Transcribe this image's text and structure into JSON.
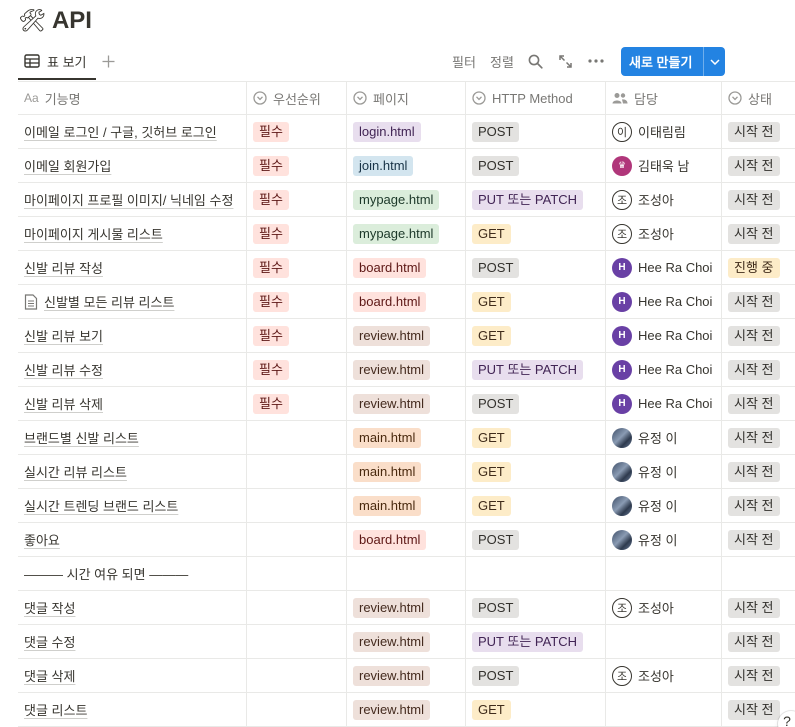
{
  "page": {
    "emoji": "🛠",
    "title": "API"
  },
  "toolbar": {
    "view_tab": "표 보기",
    "filter": "필터",
    "sort": "정렬",
    "new_button": "새로 만들기"
  },
  "columns": {
    "name": "기능명",
    "priority": "우선순위",
    "page": "페이지",
    "method": "HTTP Method",
    "assignee": "담당",
    "status": "상태"
  },
  "colors": {
    "priority_bg": "#ffe2dd",
    "priority_fg": "#5d1715",
    "method_bg": "#e3e2e0",
    "method_put_bg": "#e8deee",
    "method_get_bg": "#fdecc8",
    "status_todo_bg": "#e3e2e0",
    "status_doing_bg": "#fdecc8",
    "accent": "#2383e2"
  },
  "rows": [
    {
      "name": "이메일 로그인 / 구글, 깃허브 로그인",
      "priority": "필수",
      "page": "login.html",
      "page_color": "purple",
      "method": "POST",
      "assignee": "이태림림",
      "avatar": "outline",
      "avatar_text": "이",
      "status": "시작 전"
    },
    {
      "name": "이메일 회원가입",
      "priority": "필수",
      "page": "join.html",
      "page_color": "blue",
      "method": "POST",
      "assignee": "김태욱 남",
      "avatar": "pink",
      "avatar_text": "♛",
      "status": "시작 전"
    },
    {
      "name": "마이페이지 프로필 이미지/ 닉네임 수정",
      "priority": "필수",
      "page": "mypage.html",
      "page_color": "green",
      "method": "PUT 또는 PATCH",
      "assignee": "조성아",
      "avatar": "outline",
      "avatar_text": "조",
      "status": "시작 전"
    },
    {
      "name": "마이페이지 게시물 리스트",
      "priority": "필수",
      "page": "mypage.html",
      "page_color": "green",
      "method": "GET",
      "assignee": "조성아",
      "avatar": "outline",
      "avatar_text": "조",
      "status": "시작 전"
    },
    {
      "name": "신발 리뷰 작성",
      "priority": "필수",
      "page": "board.html",
      "page_color": "red",
      "method": "POST",
      "assignee": "Hee Ra Choi",
      "avatar": "purple",
      "avatar_text": "H",
      "status": "진행 중"
    },
    {
      "name": "신발별 모든 리뷰 리스트",
      "priority": "필수",
      "page": "board.html",
      "page_color": "red",
      "method": "GET",
      "assignee": "Hee Ra Choi",
      "avatar": "purple",
      "avatar_text": "H",
      "status": "시작 전",
      "doc_icon": true
    },
    {
      "name": "신발 리뷰 보기",
      "priority": "필수",
      "page": "review.html",
      "page_color": "brown",
      "method": "GET",
      "assignee": "Hee Ra Choi",
      "avatar": "purple",
      "avatar_text": "H",
      "status": "시작 전"
    },
    {
      "name": "신발 리뷰 수정",
      "priority": "필수",
      "page": "review.html",
      "page_color": "brown",
      "method": "PUT 또는 PATCH",
      "assignee": "Hee Ra Choi",
      "avatar": "purple",
      "avatar_text": "H",
      "status": "시작 전"
    },
    {
      "name": "신발 리뷰 삭제",
      "priority": "필수",
      "page": "review.html",
      "page_color": "brown",
      "method": "POST",
      "assignee": "Hee Ra Choi",
      "avatar": "purple",
      "avatar_text": "H",
      "status": "시작 전"
    },
    {
      "name": "브랜드별 신발 리스트",
      "priority": "",
      "page": "main.html",
      "page_color": "orange",
      "method": "GET",
      "assignee": "유정 이",
      "avatar": "photo",
      "avatar_text": "",
      "status": "시작 전"
    },
    {
      "name": "실시간 리뷰 리스트",
      "priority": "",
      "page": "main.html",
      "page_color": "orange",
      "method": "GET",
      "assignee": "유정 이",
      "avatar": "photo",
      "avatar_text": "",
      "status": "시작 전"
    },
    {
      "name": "실시간 트렌딩 브랜드 리스트",
      "priority": "",
      "page": "main.html",
      "page_color": "orange",
      "method": "GET",
      "assignee": "유정 이",
      "avatar": "photo",
      "avatar_text": "",
      "status": "시작 전"
    },
    {
      "name": "좋아요",
      "priority": "",
      "page": "board.html",
      "page_color": "red",
      "method": "POST",
      "assignee": "유정 이",
      "avatar": "photo",
      "avatar_text": "",
      "status": "시작 전"
    },
    {
      "name": "——— 시간 여유 되면 ———",
      "priority": "",
      "page": "",
      "page_color": "",
      "method": "",
      "assignee": "",
      "avatar": "",
      "avatar_text": "",
      "status": "",
      "separator": true
    },
    {
      "name": "댓글 작성",
      "priority": "",
      "page": "review.html",
      "page_color": "brown",
      "method": "POST",
      "assignee": "조성아",
      "avatar": "outline",
      "avatar_text": "조",
      "status": "시작 전"
    },
    {
      "name": "댓글 수정",
      "priority": "",
      "page": "review.html",
      "page_color": "brown",
      "method": "PUT 또는 PATCH",
      "assignee": "",
      "avatar": "",
      "avatar_text": "",
      "status": "시작 전"
    },
    {
      "name": "댓글 삭제",
      "priority": "",
      "page": "review.html",
      "page_color": "brown",
      "method": "POST",
      "assignee": "조성아",
      "avatar": "outline",
      "avatar_text": "조",
      "status": "시작 전"
    },
    {
      "name": "댓글 리스트",
      "priority": "",
      "page": "review.html",
      "page_color": "brown",
      "method": "GET",
      "assignee": "",
      "avatar": "",
      "avatar_text": "",
      "status": "시작 전"
    }
  ],
  "help": "?"
}
